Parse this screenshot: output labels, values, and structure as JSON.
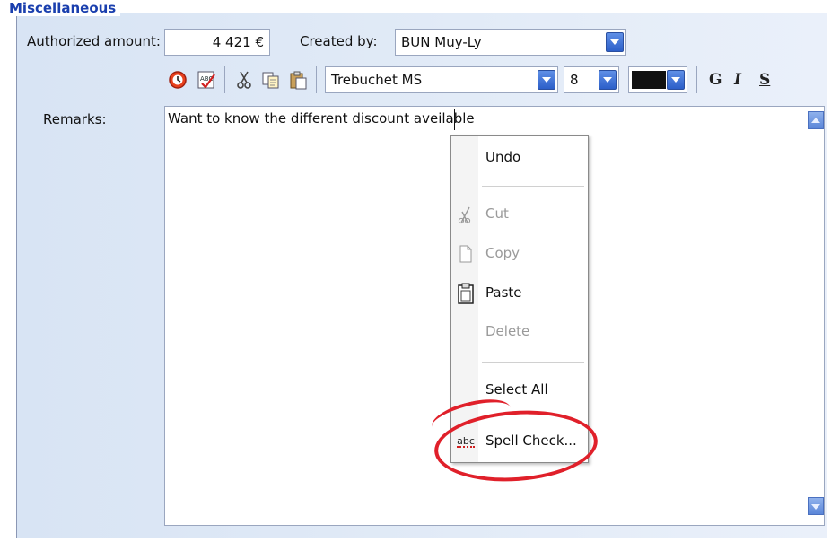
{
  "section": {
    "title": "Miscellaneous"
  },
  "amount": {
    "label": "Authorized amount:",
    "value": "4 421",
    "currency": "€"
  },
  "creator": {
    "label": "Created by:",
    "value": "BUN Muy-Ly"
  },
  "toolbar": {
    "font": "Trebuchet MS",
    "size": "8",
    "color": "#111111",
    "bold": "G",
    "italic": "I",
    "underline": "S"
  },
  "remarks": {
    "label": "Remarks:",
    "text": "Want to know the different discount aveilable"
  },
  "context_menu": {
    "undo": "Undo",
    "cut": "Cut",
    "copy": "Copy",
    "paste": "Paste",
    "delete": "Delete",
    "select_all": "Select All",
    "spell_check": "Spell Check...",
    "spell_icon_text": "abc"
  },
  "colors": {
    "accent": "#1a3fae",
    "annotation": "#e0202a",
    "panel": "#dbe6f5"
  }
}
